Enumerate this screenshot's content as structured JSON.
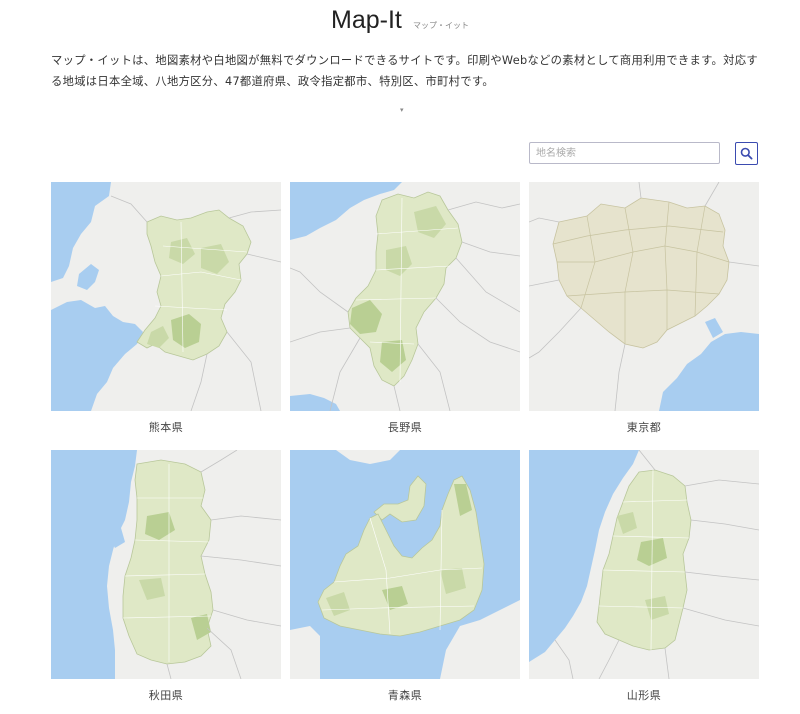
{
  "site": {
    "title": "Map-It",
    "subtitle": "マップ・イット"
  },
  "intro": "マップ・イットは、地図素材や白地図が無料でダウンロードできるサイトです。印刷やWebなどの素材として商用利用できます。対応する地域は日本全域、八地方区分、47都道府県、政令指定都市、特別区、市町村です。",
  "scroll_arrow": "▾",
  "search": {
    "placeholder": "地名検索",
    "value": "",
    "button_icon": "search-icon"
  },
  "maps": [
    {
      "name": "熊本県",
      "map_label": "熊本県"
    },
    {
      "name": "長野県",
      "map_label": "長野県"
    },
    {
      "name": "東京都",
      "map_label": "東京都"
    },
    {
      "name": "秋田県",
      "map_label": "秋田県"
    },
    {
      "name": "青森県",
      "map_label": "青森県"
    },
    {
      "name": "山形県",
      "map_label": "山形県"
    }
  ],
  "colors": {
    "sea": "#a8cdf0",
    "land": "#efefed",
    "region": "#dfe8c6",
    "region_dark": "#b9cf93",
    "tokyo": "#e6e3cd",
    "accent": "#3b4bb0"
  }
}
